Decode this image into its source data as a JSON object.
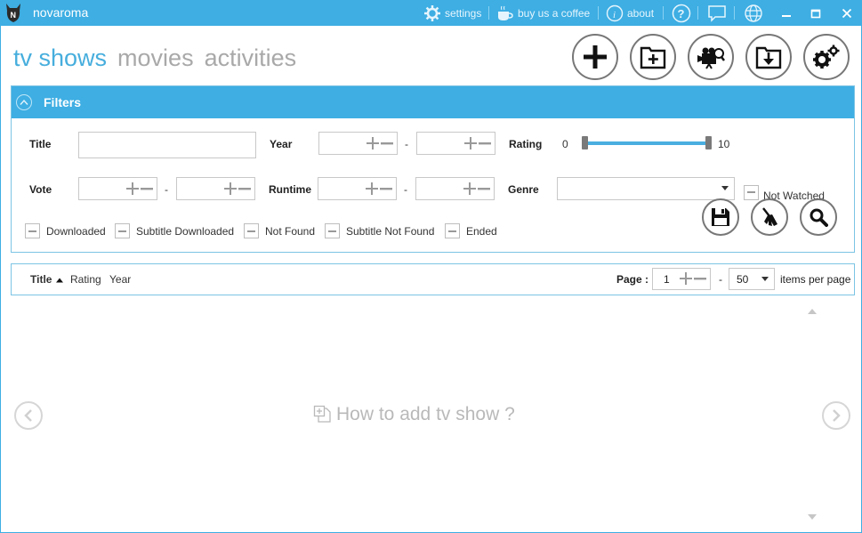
{
  "app": {
    "title": "novaroma"
  },
  "titlebar": {
    "settings": "settings",
    "coffee": "buy us a coffee",
    "about": "about"
  },
  "tabs": [
    {
      "label": "tv shows",
      "active": true
    },
    {
      "label": "movies",
      "active": false
    },
    {
      "label": "activities",
      "active": false
    }
  ],
  "filters": {
    "header": "Filters",
    "title_label": "Title",
    "title_value": "",
    "year_label": "Year",
    "year_from": "",
    "year_to": "",
    "range_sep": "-",
    "rating_label": "Rating",
    "rating_min": "0",
    "rating_max": "10",
    "vote_label": "Vote",
    "vote_from": "",
    "vote_to": "",
    "runtime_label": "Runtime",
    "runtime_from": "",
    "runtime_to": "",
    "genre_label": "Genre",
    "genre_value": "",
    "not_watched": "Not Watched",
    "checkboxes": {
      "downloaded": "Downloaded",
      "subtitle_downloaded": "Subtitle Downloaded",
      "not_found": "Not Found",
      "subtitle_not_found": "Subtitle Not Found",
      "ended": "Ended"
    }
  },
  "sortbar": {
    "title": "Title",
    "rating": "Rating",
    "year": "Year",
    "page_label": "Page :",
    "page_value": "1",
    "sep": "-",
    "per_page_value": "50",
    "items_per_page": "items per page"
  },
  "content": {
    "empty_message": "How to add tv show ?"
  },
  "colors": {
    "accent": "#3eaee3",
    "tab_active": "#47aedd",
    "tab_inactive": "#a9a9a9"
  }
}
